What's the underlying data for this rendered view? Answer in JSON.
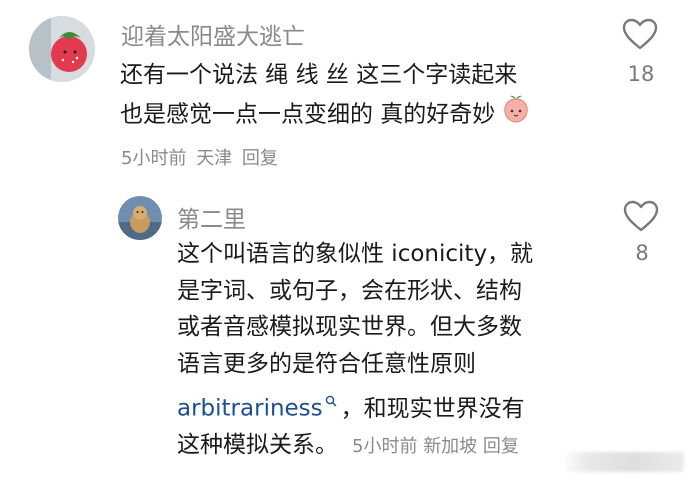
{
  "comments": [
    {
      "username": "迎着太阳盛大逃亡",
      "lines": [
        "还有一个说法 绳 线 丝 这三个字读起来",
        "也是感觉一点一点变细的 真的好奇妙"
      ],
      "emoji": "peach-face-emoji",
      "meta": {
        "time": "5小时前",
        "location": "天津",
        "reply": "回复"
      },
      "likes": "18"
    },
    {
      "username": "第二里",
      "lines": [
        "这个叫语言的象似性 iconicity，就",
        "是字词、或句子，会在形状、结构",
        "或者音感模拟现实世界。但大多数",
        "语言更多的是符合任意性原则"
      ],
      "link_text": "arbitrariness",
      "line5_rest": "，和现实世界没有",
      "line6": "这种模拟关系。",
      "meta": {
        "time": "5小时前",
        "location": "新加坡",
        "reply": "回复"
      },
      "likes": "8"
    }
  ],
  "colors": {
    "meta_gray": "#8a8a8a",
    "link_blue": "#1c4f8f",
    "heart_gray": "#7a7a7a"
  }
}
